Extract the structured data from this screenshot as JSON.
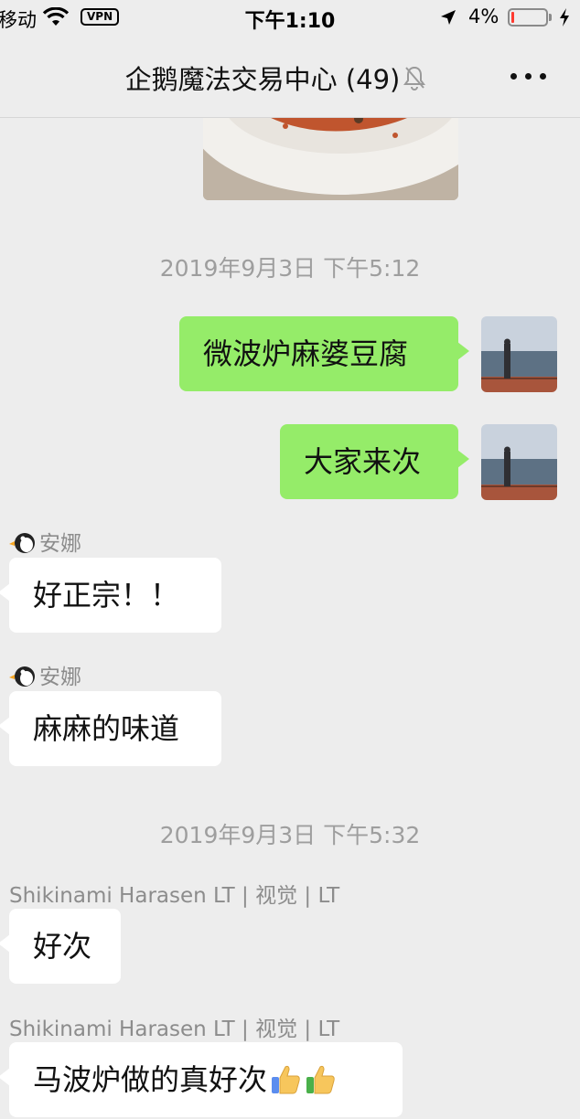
{
  "status_bar": {
    "carrier": "移动",
    "vpn": "VPN",
    "time": "下午1:10",
    "battery": "4%",
    "battery_level": 0.04
  },
  "nav": {
    "title": "企鹅魔法交易中心 (49)",
    "mute_icon": "bell-slash-icon",
    "more_icon": "more-dots-icon"
  },
  "messages": {
    "timestamp_1": "2019年9月3日 下午5:12",
    "out_1": "微波炉麻婆豆腐",
    "out_2": "大家来次",
    "sender_1": "安娜",
    "in_1": "好正宗！！",
    "sender_2": "安娜",
    "in_2": "麻麻的味道",
    "timestamp_2": "2019年9月3日 下午5:32",
    "sender_3": "Shikinami Harasen LT | 视觉 | LT",
    "in_3": "好次",
    "sender_4": "Shikinami Harasen LT | 视觉 | LT",
    "in_4": "马波炉做的真好次"
  },
  "colors": {
    "outgoing_bubble": "#95ec69",
    "incoming_bubble": "#ffffff",
    "background": "#ededed"
  }
}
